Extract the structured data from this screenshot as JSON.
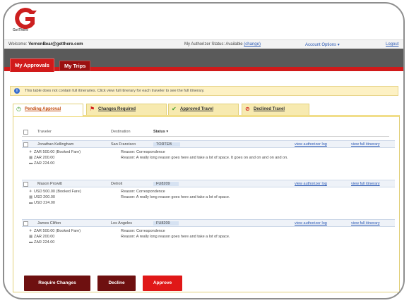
{
  "brand": {
    "logo_letter": "G",
    "logo_word": "GetThere",
    "accent": "#d11a1a",
    "logo_color": "#cc1f1f"
  },
  "topbar": {
    "welcome_prefix": "Welcome:",
    "user_email": "VernonBear@getthere.com",
    "status_prefix": "My Authorizer Status: Available",
    "status_change": "(change)",
    "account_options": "Account Options ▾",
    "logout": "Logout"
  },
  "main_tabs": [
    {
      "label": "My Approvals",
      "active": true
    },
    {
      "label": "My Trips",
      "active": false
    }
  ],
  "notice": {
    "icon": "info-icon",
    "text": "This table does not contain full itineraries. Click view full itinerary for each traveler to see the full itinerary."
  },
  "status_tabs": [
    {
      "label": "Pending Approval",
      "icon": "clock-icon",
      "active": true
    },
    {
      "label": "Changes Required",
      "icon": "flag-icon",
      "active": false
    },
    {
      "label": "Approved Travel",
      "icon": "checkmark-icon",
      "active": false
    },
    {
      "label": "Declined Travel",
      "icon": "decline-icon",
      "active": false
    }
  ],
  "table": {
    "columns": [
      "Traveler",
      "Destination",
      "Status ▾"
    ],
    "rows": [
      {
        "traveler": "Jonathan Kellingham",
        "destination": "San Francisco",
        "status": "TORTEB",
        "auth_log": "view authorizer log",
        "full_itinerary": "view full itinerary",
        "amounts": [
          "ZAR 500.00 (Booked Fare)",
          "ZAR 200.00",
          "ZAR 224.00"
        ],
        "reason": "Reason: Correspondence",
        "reason_detail": "Reason: A really long reason goes here and take a lot of space. It goes on and on and on and on."
      },
      {
        "traveler": "Mason Prowitt",
        "destination": "Detroit",
        "status": "FU8209",
        "auth_log": "view authorizer log",
        "full_itinerary": "view full itinerary",
        "amounts": [
          "USD 500.00 (Booked Fare)",
          "USD 200.00",
          "USD 224.00"
        ],
        "reason": "Reason: Correspondence",
        "reason_detail": "Reason: A really long reason goes here and take a lot of space."
      },
      {
        "traveler": "James Clifton",
        "destination": "Los Angeles",
        "status": "FU8209",
        "auth_log": "view authorizer log",
        "full_itinerary": "view full itinerary",
        "amounts": [
          "ZAR 500.00 (Booked Fare)",
          "ZAR 200.00",
          "ZAR 224.00"
        ],
        "reason": "Reason: Correspondence",
        "reason_detail": "Reason: A really long reason goes here and take a lot of space."
      }
    ]
  },
  "buttons": {
    "require_changes": "Require Changes",
    "decline": "Decline",
    "approve": "Approve"
  }
}
